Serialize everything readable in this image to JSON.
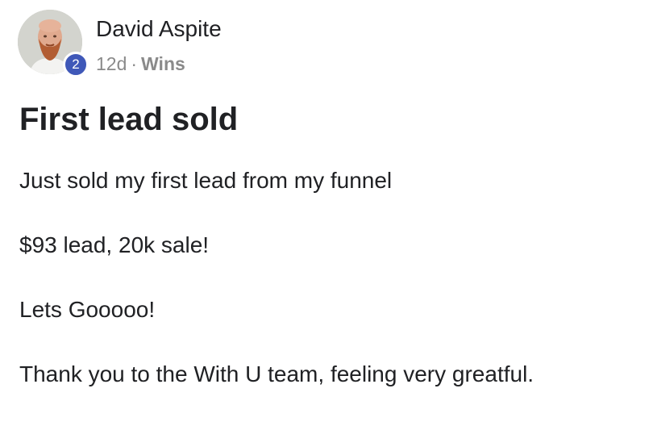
{
  "post": {
    "author": {
      "name": "David Aspite",
      "level": "2"
    },
    "meta": {
      "time": "12d",
      "separator": "·",
      "category": "Wins"
    },
    "title": "First lead sold",
    "body_lines": [
      "Just sold my first lead from my funnel",
      "$93 lead, 20k sale!",
      "Lets Gooooo!",
      "Thank you to the With U team, feeling very greatful."
    ]
  },
  "colors": {
    "badge": "#3f58b8",
    "text": "#202124",
    "meta": "#8a8a8a"
  }
}
